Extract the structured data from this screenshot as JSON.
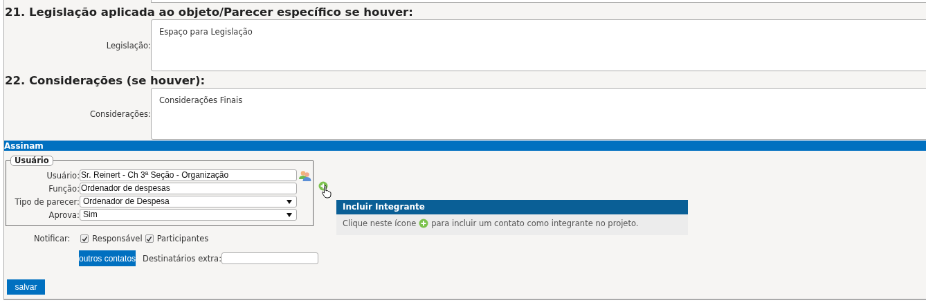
{
  "sections": [
    {
      "heading": "21. Legislação aplicada ao objeto/Parecer específico se houver:",
      "label": "Legislação:",
      "value": "Espaço para Legislação"
    },
    {
      "heading": "22. Considerações (se houver):",
      "label": "Considerações:",
      "value": "Considerações Finais"
    }
  ],
  "signers": {
    "title": "Assinam",
    "legend": "Usuário",
    "fields": [
      {
        "kind": "text",
        "label": "Usuário:",
        "value": "Sr. Reinert - Ch 3ª Seção - Organização",
        "lookup": true
      },
      {
        "kind": "text",
        "label": "Função:",
        "value": "Ordenador de despesas",
        "lookup": false
      },
      {
        "kind": "select",
        "label": "Tipo de parecer:",
        "value": "Ordenador de Despesa",
        "lookup": false
      },
      {
        "kind": "select",
        "label": "Aprova:",
        "value": "Sim",
        "lookup": false
      }
    ]
  },
  "tooltip": {
    "title": "Incluir Integrante",
    "text_before": "Clique neste ícone",
    "text_after": "para incluir um contato como integrante no projeto."
  },
  "notify": {
    "label": "Notificar:",
    "options": [
      {
        "label": "Responsável",
        "checked": true
      },
      {
        "label": "Participantes",
        "checked": true
      }
    ]
  },
  "other_contacts_button": "outros contatos",
  "extra_recipients": {
    "label": "Destinatários extra:"
  },
  "save_button": "salvar"
}
